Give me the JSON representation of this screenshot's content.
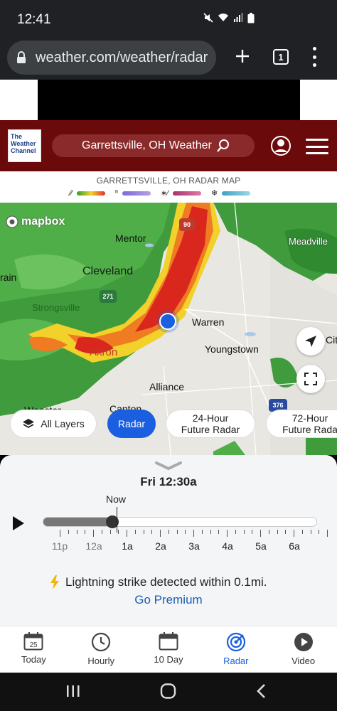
{
  "status_bar": {
    "time": "12:41"
  },
  "browser": {
    "url": "weather.com/weather/radar",
    "tab_count": "1"
  },
  "header": {
    "logo_lines": [
      "The",
      "Weather",
      "Channel"
    ],
    "search_text": "Garrettsville, OH Weather"
  },
  "map_title": "GARRETTSVILLE, OH RADAR MAP",
  "legend": [
    {
      "icon": "rain-icon",
      "symbol": "⁄⁄",
      "colors": [
        "#2e9e2e",
        "#f2d22e",
        "#e03030"
      ]
    },
    {
      "icon": "mix-icon",
      "symbol": "ᐦ",
      "colors": [
        "#7b6bd4",
        "#b59ee8"
      ]
    },
    {
      "icon": "ice-icon",
      "symbol": "∗⁄",
      "colors": [
        "#a8326a",
        "#e07aa8"
      ]
    },
    {
      "icon": "snow-icon",
      "symbol": "❄",
      "colors": [
        "#3aa3c2",
        "#9ad6e8"
      ]
    }
  ],
  "map": {
    "attribution": "mapbox",
    "cities": {
      "meadville": "Meadville",
      "mentor": "Mentor",
      "cleveland": "Cleveland",
      "strongsville": "Strongsville",
      "warren": "Warren",
      "youngstown": "Youngstown",
      "akron": "Akron",
      "alliance": "Alliance",
      "canton": "Canton",
      "wooster": "Wooster",
      "elyria_partial": "rain",
      "edge_partial": "Cit"
    },
    "highways": {
      "i90": "90",
      "i271": "271",
      "i376": "376"
    },
    "layer_buttons": {
      "all_layers": "All Layers",
      "radar": "Radar",
      "future_24_line1": "24-Hour",
      "future_24_line2": "Future Radar",
      "future_72_line1": "72-Hour",
      "future_72_line2": "Future Rada"
    }
  },
  "timeline": {
    "current_time": "Fri 12:30a",
    "now_label": "Now",
    "hours": [
      "11p",
      "12a",
      "1a",
      "2a",
      "3a",
      "4a",
      "5a",
      "6a"
    ],
    "progress": 0.25
  },
  "alert": {
    "text": "Lightning strike detected within 0.1mi.",
    "cta": "Go Premium"
  },
  "bottom_nav": {
    "today": "Today",
    "today_date": "25",
    "hourly": "Hourly",
    "ten_day": "10 Day",
    "radar": "Radar",
    "video": "Video"
  }
}
